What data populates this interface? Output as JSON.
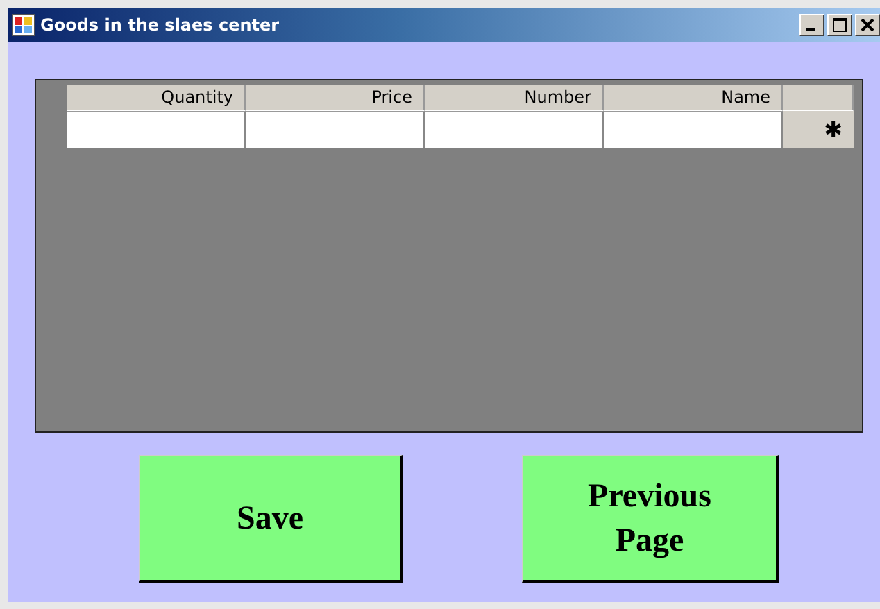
{
  "window": {
    "title": "Goods in the slaes center"
  },
  "table": {
    "columns": [
      "Quantity",
      "Price",
      "Number",
      "Name"
    ],
    "new_row": {
      "marker": "✱"
    }
  },
  "buttons": [
    {
      "label": "Save"
    },
    {
      "label": "Previous Page"
    }
  ]
}
